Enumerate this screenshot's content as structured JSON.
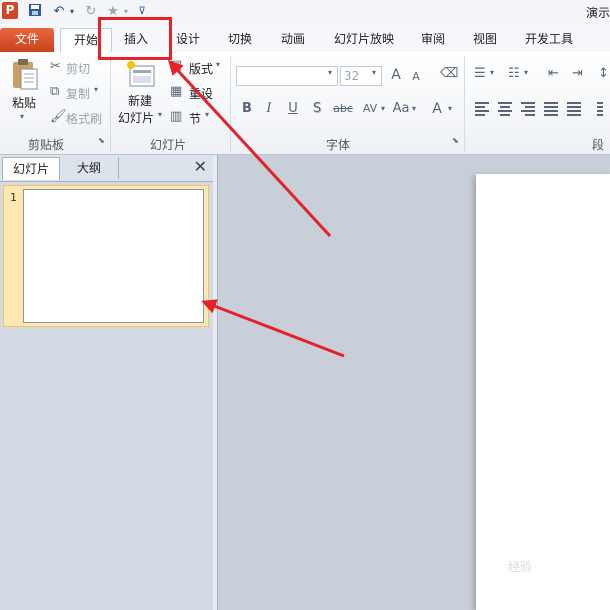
{
  "app": {
    "logo_letter": "P",
    "title": "演示",
    "qat": [
      "save-icon",
      "undo-icon",
      "redo-icon",
      "star-icon",
      "customize-icon"
    ]
  },
  "tabs": [
    "文件",
    "开始",
    "插入",
    "设计",
    "切换",
    "动画",
    "幻灯片放映",
    "审阅",
    "视图",
    "开发工具"
  ],
  "ribbon": {
    "clipboard": {
      "paste": "粘贴",
      "cut": "剪切",
      "copy": "复制",
      "format_painter": "格式刷",
      "group": "剪贴板"
    },
    "slides": {
      "new_slide_line1": "新建",
      "new_slide_line2": "幻灯片",
      "layout": "版式",
      "reset": "重设",
      "section": "节",
      "group": "幻灯片"
    },
    "font": {
      "font_name": "",
      "font_size": "32",
      "group": "字体",
      "grow": "A",
      "shrink": "A",
      "bold": "B",
      "italic": "I",
      "underline": "U",
      "shadow": "S",
      "strike": "abc",
      "spacing": "AV",
      "case": "Aa",
      "color": "A"
    },
    "paragraph": {
      "group": "段落"
    }
  },
  "left_pane": {
    "tab_slides": "幻灯片",
    "tab_outline": "大纲",
    "close": "✕",
    "slide_number": "1"
  },
  "watermark": "经验",
  "colors": {
    "file_tab": "#d24726",
    "annotation": "#e3232a",
    "thumb_selected": "#fde9b0"
  }
}
